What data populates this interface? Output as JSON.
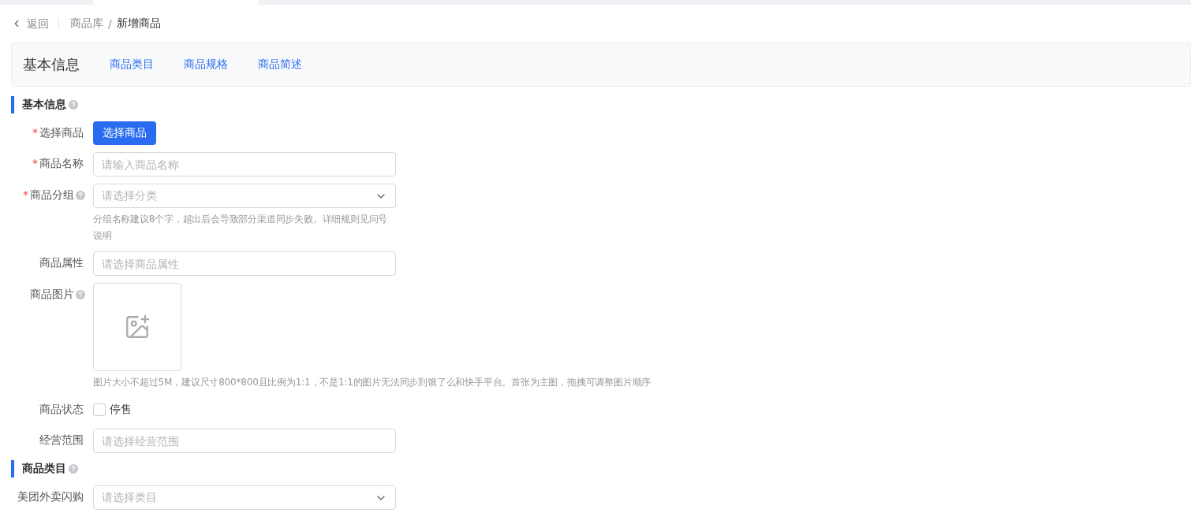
{
  "breadcrumb": {
    "back": "返回",
    "separator": "/",
    "items": [
      {
        "label": "商品库",
        "current": false
      },
      {
        "label": "新增商品",
        "current": true
      }
    ]
  },
  "anchor_tabs": [
    {
      "label": "基本信息",
      "selected": true
    },
    {
      "label": "商品类目",
      "selected": false
    },
    {
      "label": "商品规格",
      "selected": false
    },
    {
      "label": "商品简述",
      "selected": false
    }
  ],
  "sections": [
    {
      "title": "基本信息",
      "help": true,
      "fields": [
        {
          "kind": "button",
          "label": "选择商品",
          "required_mark": "*",
          "help": false,
          "button": "选择商品"
        },
        {
          "kind": "input",
          "label": "商品名称",
          "required_mark": "*",
          "help": false,
          "placeholder": "请输入商品名称"
        },
        {
          "kind": "select",
          "label": "商品分组",
          "required_mark": "*",
          "help": true,
          "placeholder": "请选择分类",
          "hint": "分组名称建议8个字，超出后会导致部分渠道同步失败。详细规则见问号说明"
        },
        {
          "kind": "input",
          "label": "商品属性",
          "help": false,
          "placeholder": "请选择商品属性"
        },
        {
          "kind": "upload",
          "label": "商品图片",
          "help": true,
          "hint": "图片大小不超过5M，建议尺寸800*800且比例为1:1，不是1:1的图片无法同步到饿了么和快手平台。首张为主图，拖拽可调整图片顺序"
        },
        {
          "kind": "checkbox",
          "label": "商品状态",
          "help": false,
          "option": "停售",
          "checked": false
        },
        {
          "kind": "input",
          "label": "经营范围",
          "help": false,
          "placeholder": "请选择经营范围"
        }
      ]
    },
    {
      "title": "商品类目",
      "help": true,
      "fields": [
        {
          "kind": "select",
          "label": "美团外卖闪购",
          "help": false,
          "placeholder": "请选择类目"
        }
      ]
    }
  ]
}
